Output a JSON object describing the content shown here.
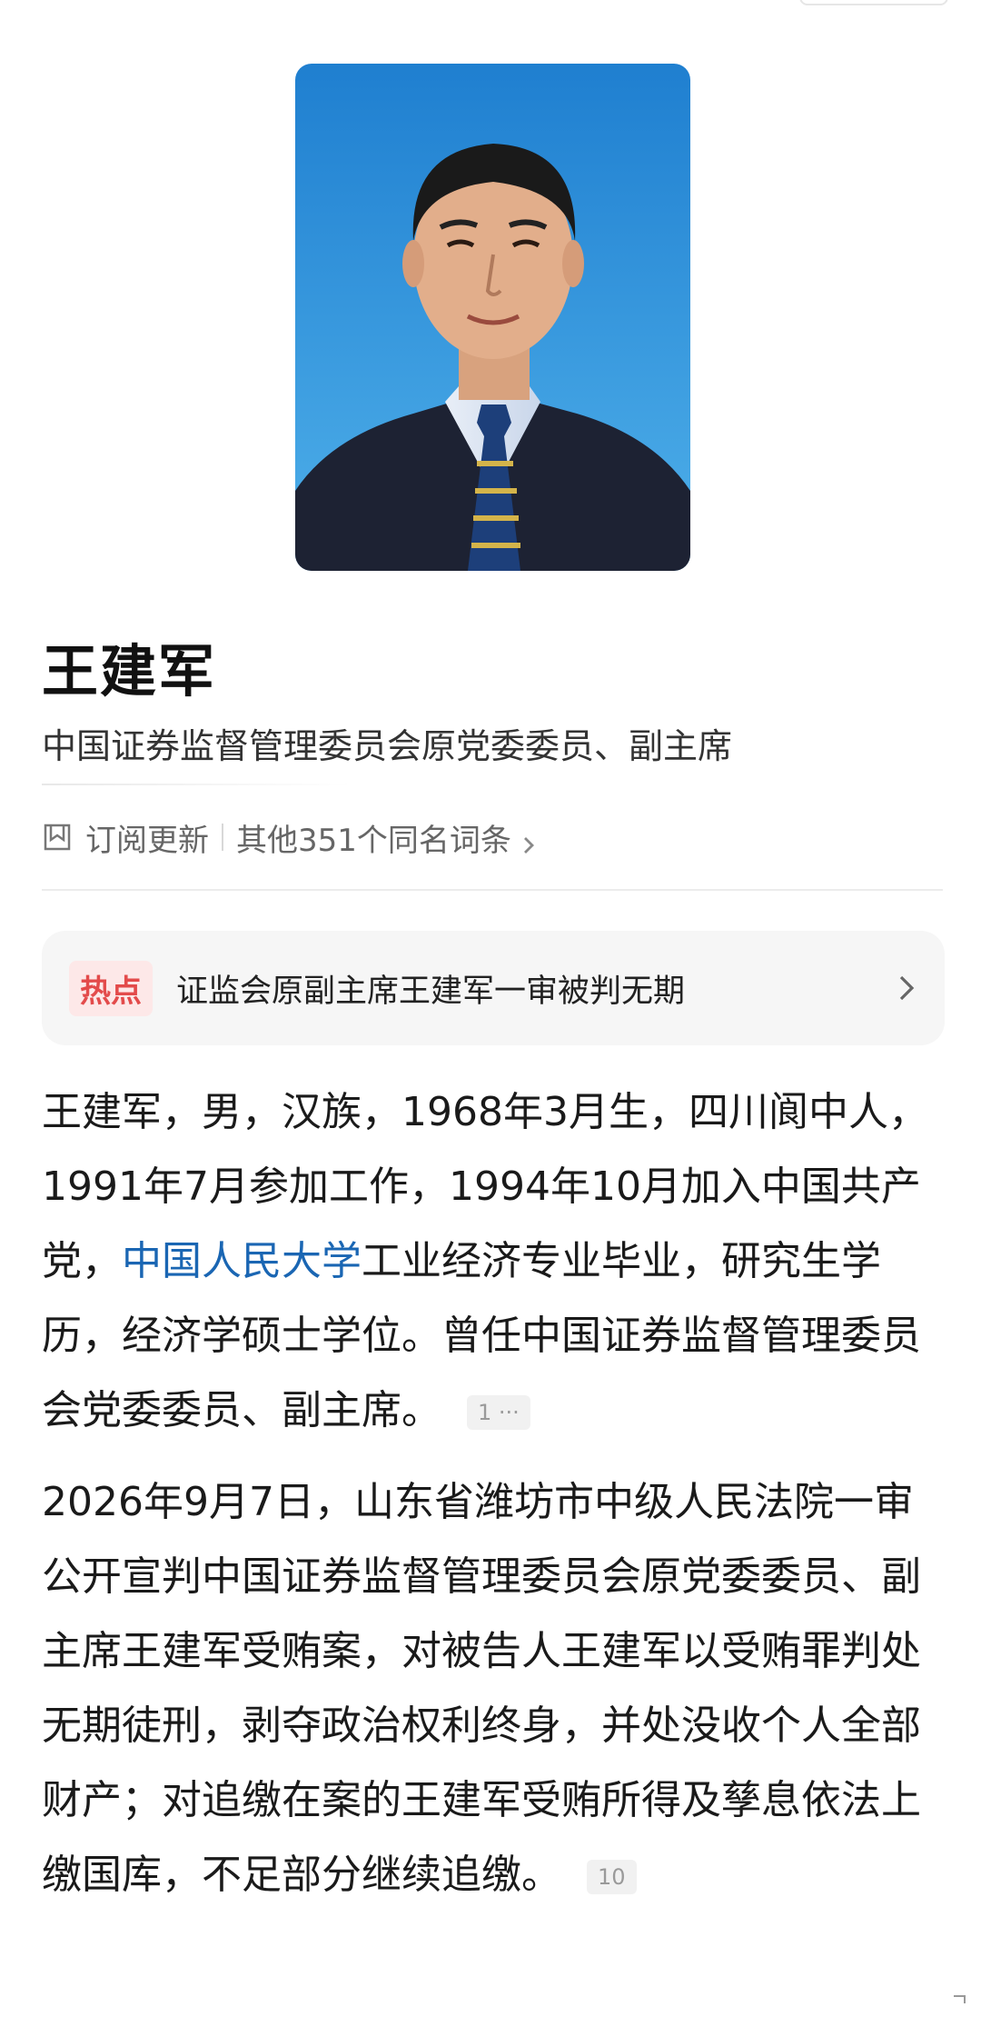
{
  "profile": {
    "name": "王建军",
    "title": "中国证券监督管理委员会原党委委员、副主席"
  },
  "actions": {
    "subscribe_label": "订阅更新",
    "same_name_label": "其他351个同名词条"
  },
  "hot": {
    "tag": "热点",
    "headline": "证监会原副主席王建军一审被判无期"
  },
  "bio": {
    "para1_before_link": "王建军，男，汉族，1968年3月生，四川阆中人，1991年7月参加工作，1994年10月加入中国共产党，",
    "para1_link": "中国人民大学",
    "para1_after_link": "工业经济专业毕业，研究生学历，经济学硕士学位。曾任中国证券监督管理委员会党委委员、副主席。",
    "para1_cite": "1 ···",
    "para2_text": "2026年9月7日，山东省潍坊市中级人民法院一审公开宣判中国证券监督管理委员会原党委委员、副主席王建军受贿案，对被告人王建军以受贿罪判处无期徒刑，剥夺政治权利终身，并处没收个人全部财产；对追缴在案的王建军受贿所得及孳息依法上缴国库，不足部分继续追缴。",
    "para2_cite": "10"
  },
  "colors": {
    "link": "#1a66b3",
    "hot_tag_text": "#e34b4b",
    "hot_tag_bg": "#fde8e8",
    "photo_bg": "#2e8fd4"
  },
  "icons": {
    "subscribe": "bookmark-icon",
    "more": "chevron-right-icon"
  }
}
